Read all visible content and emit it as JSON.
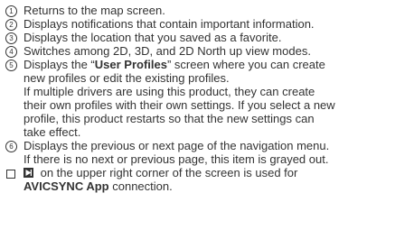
{
  "items": [
    {
      "number": "1",
      "lines": [
        "Returns to the map screen."
      ]
    },
    {
      "number": "2",
      "lines": [
        "Displays notifications that contain important information."
      ]
    },
    {
      "number": "3",
      "lines": [
        "Displays the location that you saved as a favorite."
      ]
    },
    {
      "number": "4",
      "lines": [
        "Switches among 2D, 3D, and 2D North up view modes."
      ]
    },
    {
      "number": "5",
      "line1_pre": "Displays the “",
      "line1_bold": "User Profiles",
      "line1_post": "” screen where you can create",
      "lines": [
        "new profiles or edit the existing profiles.",
        "If multiple drivers are using this product, they can create",
        "their own profiles with their own settings. If you select a new",
        "profile, this product restarts so that the new settings can",
        "take effect."
      ]
    },
    {
      "number": "6",
      "lines": [
        "Displays the previous or next page of the navigation menu.",
        "If there is no next or previous page, this item is grayed out."
      ]
    }
  ],
  "note": {
    "icon": "avicsync-app-icon",
    "line1_post": " on the upper right corner of the screen is used for",
    "line2_bold": "AVICSYNC App",
    "line2_post": " connection."
  }
}
